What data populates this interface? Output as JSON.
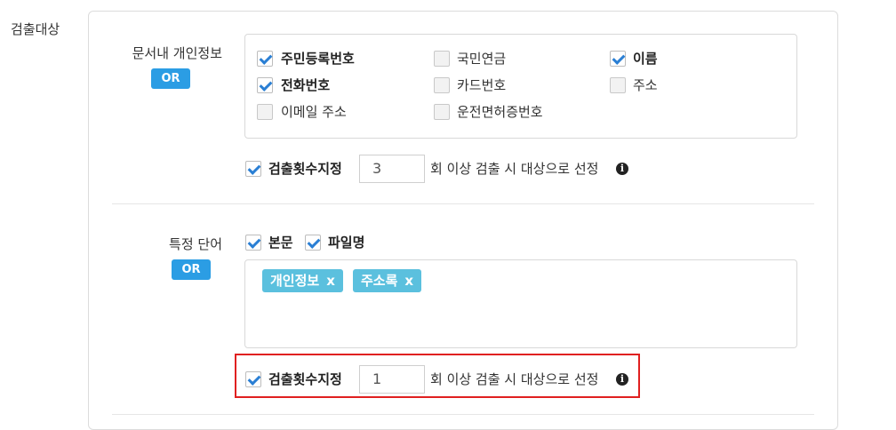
{
  "section_title": "검출대상",
  "personal_info": {
    "label": "문서내 개인정보",
    "or_badge": "OR",
    "options": [
      {
        "label": "주민등록번호",
        "checked": true
      },
      {
        "label": "국민연금",
        "checked": false
      },
      {
        "label": "이름",
        "checked": true
      },
      {
        "label": "전화번호",
        "checked": true
      },
      {
        "label": "카드번호",
        "checked": false
      },
      {
        "label": "주소",
        "checked": false
      },
      {
        "label": "이메일 주소",
        "checked": false
      },
      {
        "label": "운전면허증번호",
        "checked": false
      }
    ],
    "count_checkbox_label": "검출횟수지정",
    "count_checked": true,
    "count_value": "3",
    "count_suffix": "회 이상 검출 시 대상으로 선정"
  },
  "keyword": {
    "label": "특정 단어",
    "or_badge": "OR",
    "options": [
      {
        "label": "본문",
        "checked": true
      },
      {
        "label": "파일명",
        "checked": true
      }
    ],
    "tags": [
      {
        "label": "개인정보",
        "remove": "x"
      },
      {
        "label": "주소록",
        "remove": "x"
      }
    ],
    "count_checkbox_label": "검출횟수지정",
    "count_checked": true,
    "count_value": "1",
    "count_suffix": "회 이상 검출 시 대상으로 선정"
  },
  "colors": {
    "or_badge": "#2b9de4",
    "tag": "#5bc0de",
    "checkmark": "#2a7fd4",
    "highlight": "#e02020"
  },
  "icons": {
    "info": "info-icon",
    "check": "check-icon"
  }
}
